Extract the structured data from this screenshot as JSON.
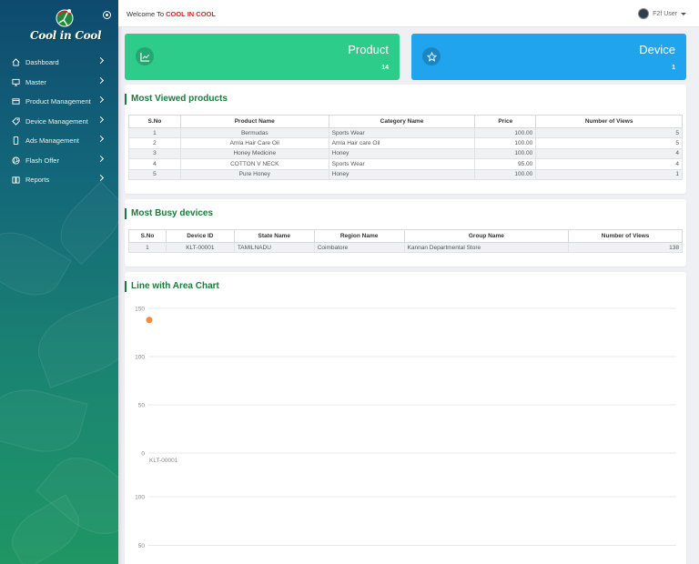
{
  "brand": {
    "logo_text": "Cool in Cool"
  },
  "header": {
    "welcome_prefix": "Welcome To ",
    "welcome_brand": "COOL IN COOL",
    "user_name": "F2f User"
  },
  "sidebar": {
    "items": [
      {
        "label": "Dashboard",
        "icon": "home-icon"
      },
      {
        "label": "Master",
        "icon": "monitor-icon"
      },
      {
        "label": "Product Management",
        "icon": "box-icon"
      },
      {
        "label": "Device Management",
        "icon": "tag-icon"
      },
      {
        "label": "Ads Management",
        "icon": "tablet-icon"
      },
      {
        "label": "Flash Offer",
        "icon": "aperture-icon"
      },
      {
        "label": "Reports",
        "icon": "book-icon"
      }
    ]
  },
  "cards": {
    "product": {
      "title": "Product",
      "count": "14",
      "icon": "trend-chart-icon",
      "color": "#2ecc8a"
    },
    "device": {
      "title": "Device",
      "count": "1",
      "icon": "star-icon",
      "color": "#20a4ee"
    }
  },
  "most_viewed": {
    "title": "Most Viewed products",
    "headers": [
      "S.No",
      "Product Name",
      "Category Name",
      "Price",
      "Number of Views"
    ],
    "rows": [
      [
        "1",
        "Bermudas",
        "Sports Wear",
        "100.00",
        "5"
      ],
      [
        "2",
        "Amla Hair Care Oil",
        "Amla Hair care Oil",
        "100.00",
        "5"
      ],
      [
        "3",
        "Honey Medicine",
        "Honey",
        "100.00",
        "4"
      ],
      [
        "4",
        "COTTON V NECK",
        "Sports Wear",
        "95.00",
        "4"
      ],
      [
        "5",
        "Pure Honey",
        "Honey",
        "100.00",
        "1"
      ]
    ]
  },
  "busy_devices": {
    "title": "Most Busy devices",
    "headers": [
      "S.No",
      "Device ID",
      "State Name",
      "Region Name",
      "Group Name",
      "Number of Views"
    ],
    "rows": [
      [
        "1",
        "KLT-00001",
        "TAMILNADU",
        "Coimbatore",
        "Kannan Departmental Store",
        "138"
      ]
    ]
  },
  "chart_panel": {
    "title": "Line with Area Chart"
  },
  "chart_data": {
    "type": "line",
    "categories": [
      "KLT-00001"
    ],
    "series": [
      {
        "values": [
          138
        ],
        "color": "#f08c3c"
      }
    ],
    "yticks": [
      0,
      50,
      100,
      150
    ],
    "ylim": [
      0,
      150
    ],
    "second_axis_ticks": [
      100,
      50
    ],
    "grid": true
  }
}
